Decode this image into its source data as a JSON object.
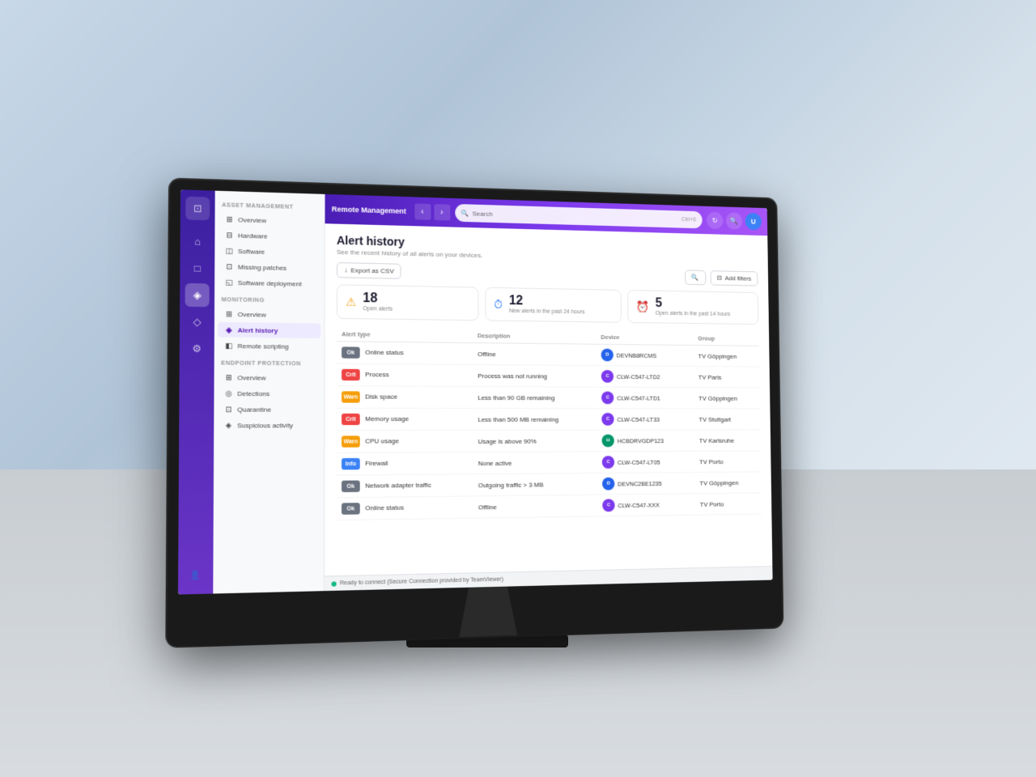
{
  "app": {
    "title": "Remote Management",
    "search_placeholder": "Search",
    "search_shortcut": "Ctrl+S"
  },
  "sidebar_icons": [
    {
      "name": "logo",
      "icon": "⊡",
      "active": false
    },
    {
      "name": "home",
      "icon": "⌂",
      "active": false
    },
    {
      "name": "devices",
      "icon": "□",
      "active": false
    },
    {
      "name": "monitoring",
      "icon": "◈",
      "active": true
    },
    {
      "name": "diamond",
      "icon": "◇",
      "active": false
    },
    {
      "name": "settings",
      "icon": "⚙",
      "active": false
    },
    {
      "name": "user",
      "icon": "👤",
      "active": false
    }
  ],
  "nav": {
    "asset_section": "ASSET MANAGEMENT",
    "asset_items": [
      {
        "label": "Overview",
        "icon": "⊞",
        "active": false
      },
      {
        "label": "Hardware",
        "icon": "⊟",
        "active": false
      },
      {
        "label": "Software",
        "icon": "◫",
        "active": false
      },
      {
        "label": "Missing patches",
        "icon": "⊡",
        "active": false
      },
      {
        "label": "Software deployment",
        "icon": "◱",
        "active": false
      }
    ],
    "monitoring_section": "MONITORING",
    "monitoring_items": [
      {
        "label": "Overview",
        "icon": "⊞",
        "active": false
      },
      {
        "label": "Alert history",
        "icon": "◈",
        "active": true
      },
      {
        "label": "Remote scripting",
        "icon": "◧",
        "active": false
      }
    ],
    "endpoint_section": "ENDPOINT PROTECTION",
    "endpoint_items": [
      {
        "label": "Overview",
        "icon": "⊞",
        "active": false
      },
      {
        "label": "Detections",
        "icon": "◎",
        "active": false
      },
      {
        "label": "Quarantine",
        "icon": "⊡",
        "active": false
      },
      {
        "label": "Suspicious activity",
        "icon": "◈",
        "active": false
      }
    ]
  },
  "page": {
    "title": "Alert history",
    "subtitle": "See the recent history of all alerts on your devices.",
    "export_label": "Export as CSV",
    "filter_label": "Add filters",
    "search_icon": "🔍"
  },
  "stats": [
    {
      "number": "18",
      "label": "Open alerts",
      "icon": "⚠",
      "type": "warn"
    },
    {
      "number": "12",
      "label": "New alerts in the past 24 hours",
      "icon": "⏱",
      "type": "blue"
    },
    {
      "number": "5",
      "label": "Open alerts in the past 14 hours",
      "icon": "⏰",
      "type": "green"
    }
  ],
  "table": {
    "columns": [
      "Alert type",
      "Description",
      "Device",
      "Group"
    ],
    "rows": [
      {
        "severity": "Ok",
        "sev_class": "sev-ok",
        "type": "Online status",
        "description": "Offline",
        "device": "DEVNB8RCMS",
        "device_color": "blue",
        "group": "TV Göppingen"
      },
      {
        "severity": "Crit",
        "sev_class": "sev-crit",
        "type": "Process",
        "description": "Process was not running",
        "device": "CLW-C547-LTD2",
        "device_color": "purple",
        "group": "TV Paris"
      },
      {
        "severity": "Warn",
        "sev_class": "sev-warn",
        "type": "Disk space",
        "description": "Less than 90 GB remaining",
        "device": "CLW-C547-LTD1",
        "device_color": "purple",
        "group": "TV Göppingen"
      },
      {
        "severity": "Crit",
        "sev_class": "sev-crit",
        "type": "Memory usage",
        "description": "Less than 500 MB remaining",
        "device": "CLW-C547-LT33",
        "device_color": "purple",
        "group": "TV Stuttgart"
      },
      {
        "severity": "Warn",
        "sev_class": "sev-warn",
        "type": "CPU usage",
        "description": "Usage is above 90%",
        "device": "HCBDRVGDP123",
        "device_color": "green",
        "group": "TV Karlsruhe"
      },
      {
        "severity": "Info",
        "sev_class": "sev-info",
        "type": "Firewall",
        "description": "None active",
        "device": "CLW-C547-LT05",
        "device_color": "purple",
        "group": "TV Porto"
      },
      {
        "severity": "Ok",
        "sev_class": "sev-ok",
        "type": "Network adapter traffic",
        "description": "Outgoing traffic > 3 MB",
        "device": "DEVNC2BE1235",
        "device_color": "blue",
        "group": "TV Göppingen"
      },
      {
        "severity": "Ok",
        "sev_class": "sev-ok",
        "type": "Online status",
        "description": "Offline",
        "device": "CLW-C547-XXX",
        "device_color": "purple",
        "group": "TV Porto"
      }
    ]
  },
  "statusbar": {
    "status": "Ready to connect (Secure Connection provided by TeamViewer)"
  }
}
